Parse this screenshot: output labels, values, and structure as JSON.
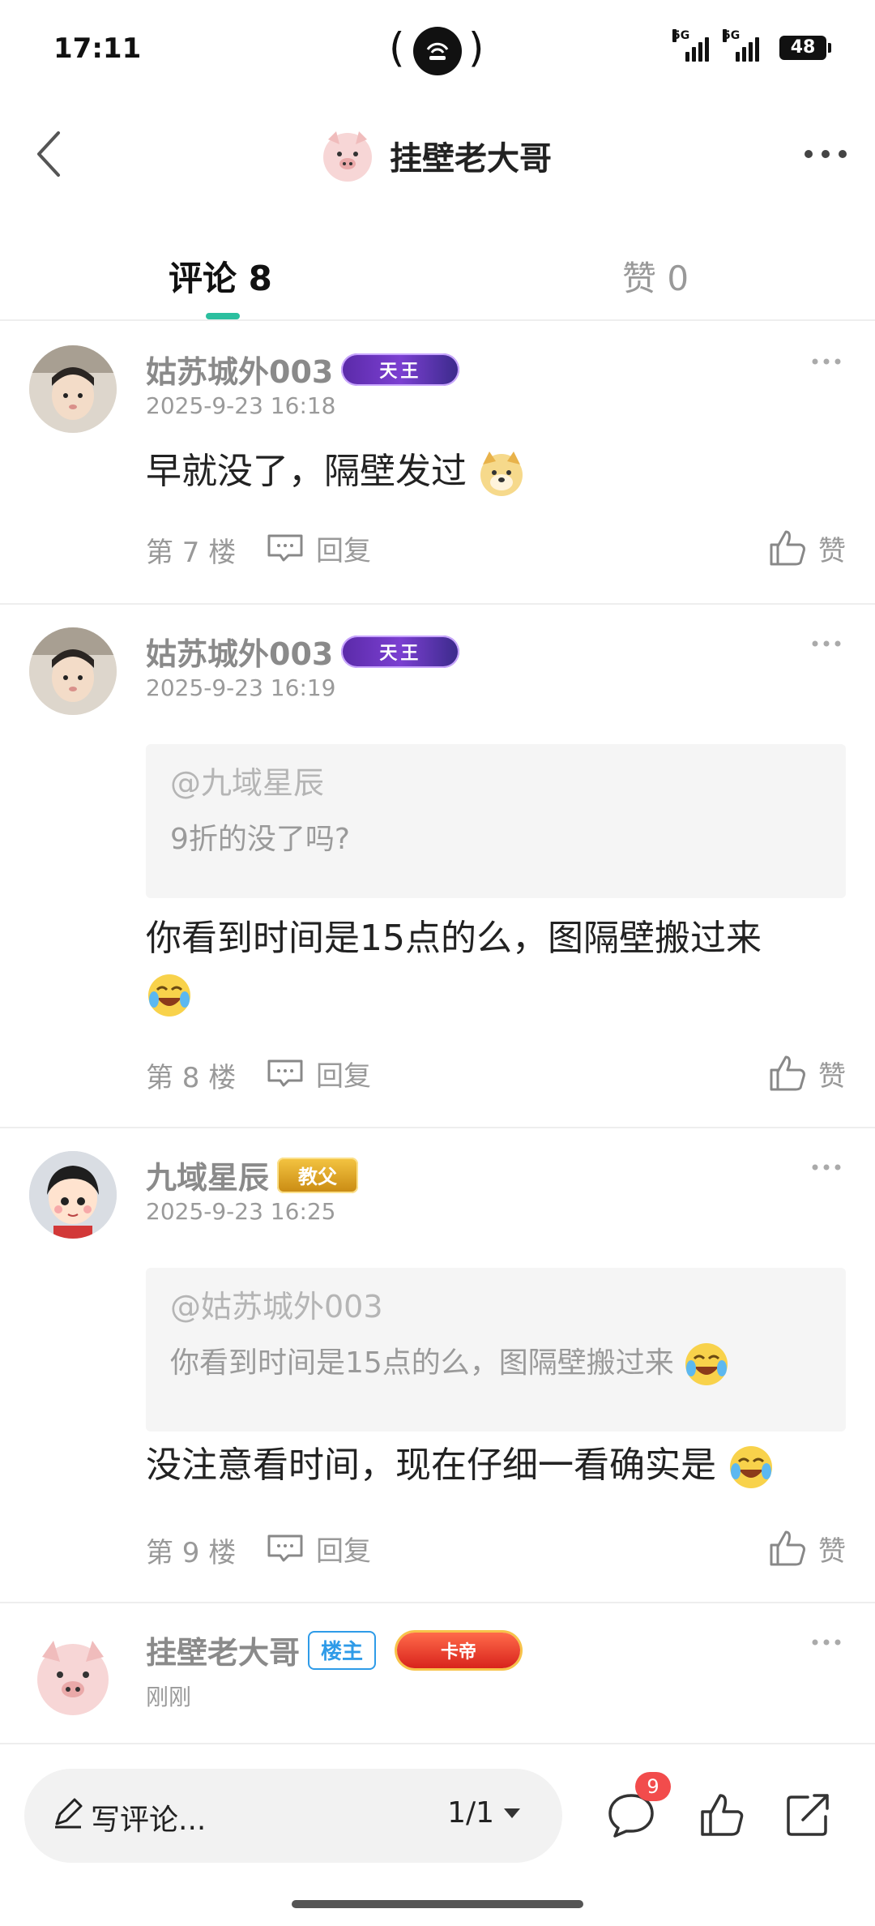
{
  "status_bar": {
    "time": "17:11",
    "network_1": "5G",
    "network_2": "5G",
    "battery": "48"
  },
  "nav": {
    "title": "挂壁老大哥"
  },
  "tabs": [
    {
      "label": "评论 8",
      "active": true
    },
    {
      "label": "赞 0",
      "active": false
    }
  ],
  "comments": [
    {
      "username": "姑苏城外003",
      "badge": "天王",
      "time": "2025-9-23 16:18",
      "text": "早就没了，隔壁发过",
      "floor": "第 7 楼",
      "reply_label": "回复",
      "like_label": "赞"
    },
    {
      "username": "姑苏城外003",
      "badge": "天王",
      "time": "2025-9-23 16:19",
      "quote_user": "@九域星辰",
      "quote_text": "9折的没了吗?",
      "text_line1": "你看到时间是15点的么，图隔壁搬过来",
      "floor": "第 8 楼",
      "reply_label": "回复",
      "like_label": "赞"
    },
    {
      "username": "九域星辰",
      "badge": "教父",
      "time": "2025-9-23 16:25",
      "quote_user": "@姑苏城外003",
      "quote_text": "你看到时间是15点的么，图隔壁搬过来",
      "text": "没注意看时间，现在仔细一看确实是",
      "floor": "第 9 楼",
      "reply_label": "回复",
      "like_label": "赞"
    },
    {
      "username": "挂壁老大哥",
      "badge_owner": "楼主",
      "badge": "卡帝",
      "time": "刚刚"
    }
  ],
  "bottom_bar": {
    "placeholder": "写评论...",
    "pager": "1/1",
    "comment_count": "9"
  },
  "colors": {
    "accent": "#2bbf9f",
    "badge_red": "#f24c4c",
    "owner_blue": "#2e9be8"
  }
}
